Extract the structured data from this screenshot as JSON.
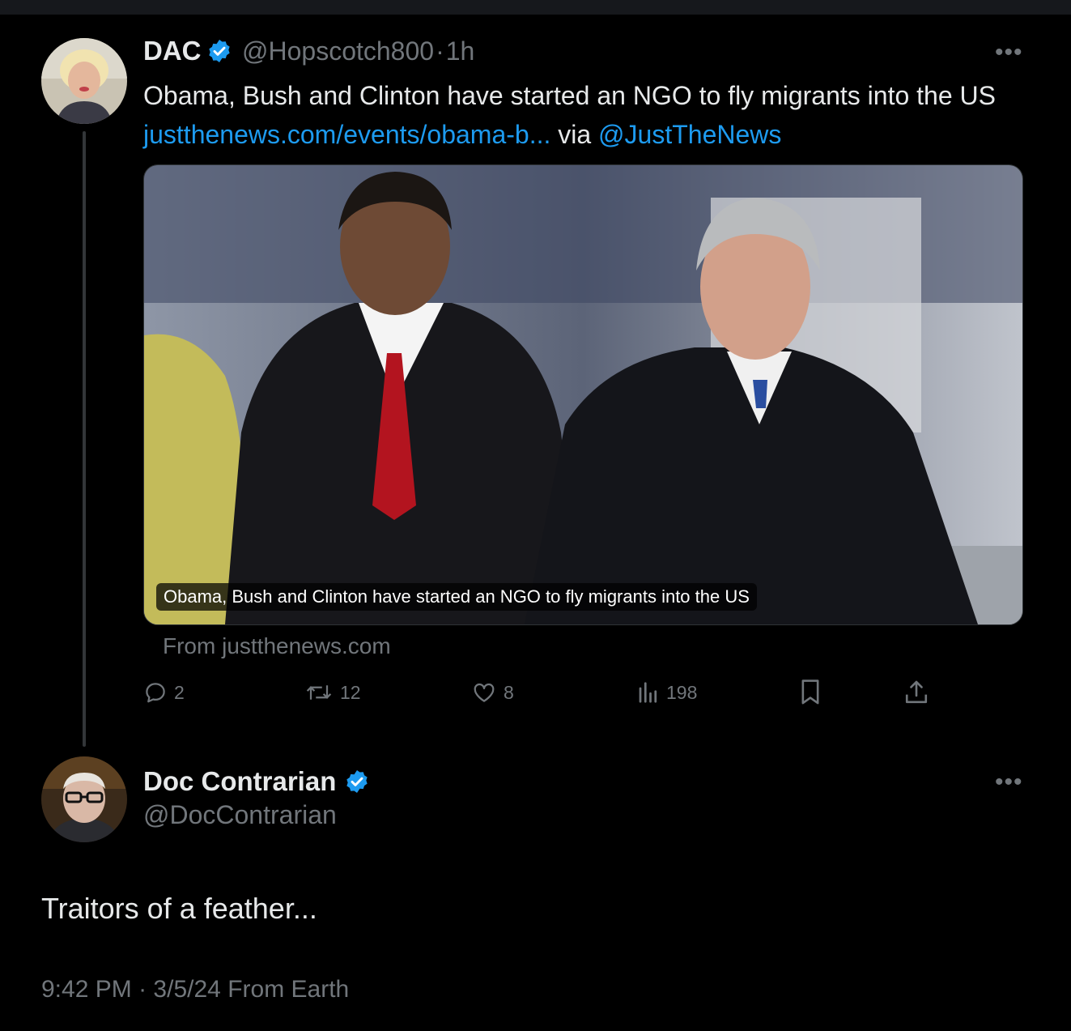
{
  "original_post": {
    "author_name": "DAC",
    "handle": "@Hopscotch800",
    "separator": "·",
    "time": "1h",
    "more_label": "•••",
    "text": "Obama, Bush and Clinton have started an NGO to fly migrants into the US",
    "link_text": "justthenews.com/events/obama-b...",
    "via_label": "via",
    "mention": "@JustTheNews",
    "card": {
      "caption": "Obama, Bush and Clinton have started an NGO to fly migrants into the US",
      "from_label": "From justthenews.com"
    },
    "actions": {
      "replies": "2",
      "reposts": "12",
      "likes": "8",
      "views": "198"
    }
  },
  "reply_post": {
    "author_name": "Doc Contrarian",
    "handle": "@DocContrarian",
    "more_label": "•••",
    "text": "Traitors of a feather...",
    "time": "9:42 PM",
    "separator": "·",
    "date": "3/5/24",
    "source": "From Earth"
  },
  "colors": {
    "background": "#000000",
    "text_primary": "#e7e9ea",
    "text_secondary": "#71767b",
    "link": "#1d9bf0",
    "verified_badge": "#1d9bf0"
  }
}
